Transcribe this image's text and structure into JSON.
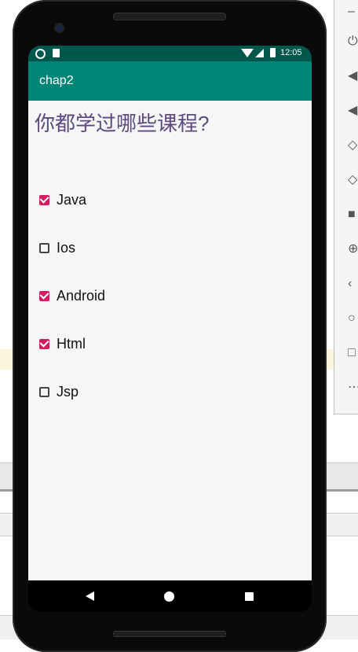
{
  "status_bar": {
    "time": "12:05",
    "icons": [
      "notification-circle-icon",
      "sd-card-icon",
      "wifi-icon",
      "signal-icon",
      "battery-icon"
    ]
  },
  "app_bar": {
    "title": "chap2"
  },
  "content": {
    "question": "你都学过哪些课程?",
    "options": [
      {
        "label": "Java",
        "checked": true
      },
      {
        "label": "Ios",
        "checked": false
      },
      {
        "label": "Android",
        "checked": true
      },
      {
        "label": "Html",
        "checked": true
      },
      {
        "label": "Jsp",
        "checked": false
      }
    ]
  },
  "nav_bar": {
    "icons": [
      "back-icon",
      "home-icon",
      "recents-icon"
    ]
  },
  "colors": {
    "status_bar": "#00574b",
    "app_bar": "#008577",
    "accent": "#d81b60",
    "question_text": "#5a4a7d"
  }
}
